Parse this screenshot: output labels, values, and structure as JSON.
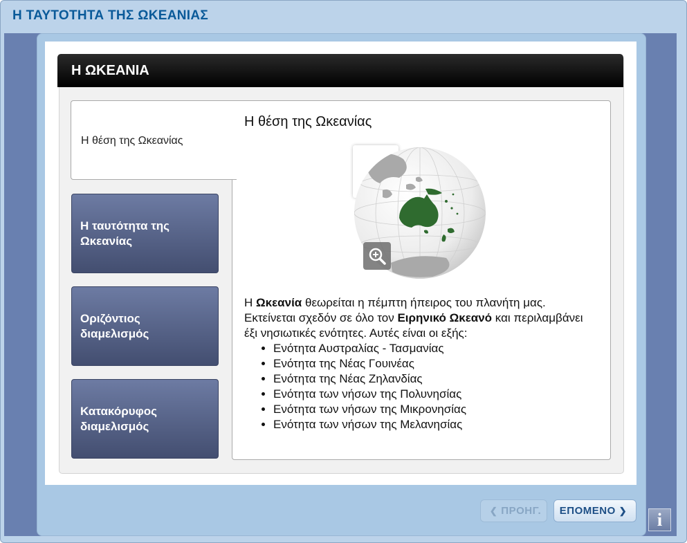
{
  "app": {
    "title": "Η ΤΑΥΤΟΤΗΤΑ ΤΗΣ ΩΚΕΑΝΙΑΣ"
  },
  "panel": {
    "title": "Η ΩΚΕΑΝΙΑ"
  },
  "tabs": [
    {
      "label": "Η θέση της Ωκεανίας",
      "active": true
    },
    {
      "label": "Η ταυτότητα της Ωκεανίας",
      "active": false
    },
    {
      "label": "Οριζόντιος διαμελισμός",
      "active": false
    },
    {
      "label": "Κατακόρυφος διαμελισμός",
      "active": false
    }
  ],
  "detail": {
    "heading": "Η θέση της Ωκεανίας",
    "image_icon": "globe-oceania-map",
    "zoom_icon": "zoom-in-icon",
    "intro": {
      "t1": "Η ",
      "b1": "Ωκεανία",
      "t2": " θεωρείται η πέμπτη ήπειρος του πλανήτη μας. Εκτείνεται σχεδόν σε όλο τον ",
      "b2": "Ειρηνικό Ωκεανό",
      "t3": " και περιλαμβάνει έξι νησιωτικές ενότητες. Αυτές είναι οι εξής:"
    },
    "list": [
      "Ενότητα Αυστραλίας - Τασμανίας",
      "Ενότητα της Νέας Γουινέας",
      "Ενότητα της Νέας Ζηλανδίας",
      "Ενότητα των νήσων της Πολυνησίας",
      "Ενότητα των νήσων της Μικρονησίας",
      "Ενότητα των νήσων της Μελανησίας"
    ]
  },
  "nav": {
    "prev_label": "ΠΡΟΗΓ.",
    "next_label": "ΕΠΟΜΕΝΟ",
    "prev_enabled": false,
    "info_label": "i"
  },
  "colors": {
    "title_blue": "#0a5a99",
    "tab_gradient_top": "#6d7ba3",
    "tab_gradient_bottom": "#434e70",
    "land_highlight": "#2f6b2f",
    "stage_blue": "#6980b0"
  }
}
